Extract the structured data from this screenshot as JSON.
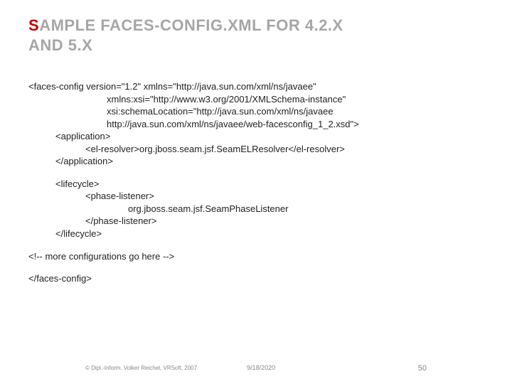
{
  "title": {
    "prefix_red": "S",
    "rest_line1": "AMPLE FACES-CONFIG.XML FOR 4.2.X",
    "line2": "AND 5.X"
  },
  "code": {
    "l1": "<faces-config version=\"1.2\" xmlns=\"http://java.sun.com/xml/ns/javaee\"",
    "l2": "xmlns:xsi=\"http://www.w3.org/2001/XMLSchema-instance\"",
    "l3": "xsi:schemaLocation=\"http://java.sun.com/xml/ns/javaee",
    "l4": "http://java.sun.com/xml/ns/javaee/web-facesconfig_1_2.xsd\">",
    "l5": "<application>",
    "l6": "<el-resolver>org.jboss.seam.jsf.SeamELResolver</el-resolver>",
    "l7": "</application>",
    "l8": "<lifecycle>",
    "l9": "<phase-listener>",
    "l10": "org.jboss.seam.jsf.SeamPhaseListener",
    "l11": "</phase-listener>",
    "l12": "</lifecycle>",
    "l13": "<!-- more configurations go here -->",
    "l14": "</faces-config>"
  },
  "footer": {
    "credit": "© Dipl.-Inform. Volker Reichel, VRSoft, 2007",
    "date": "9/18/2020",
    "page": "50"
  }
}
